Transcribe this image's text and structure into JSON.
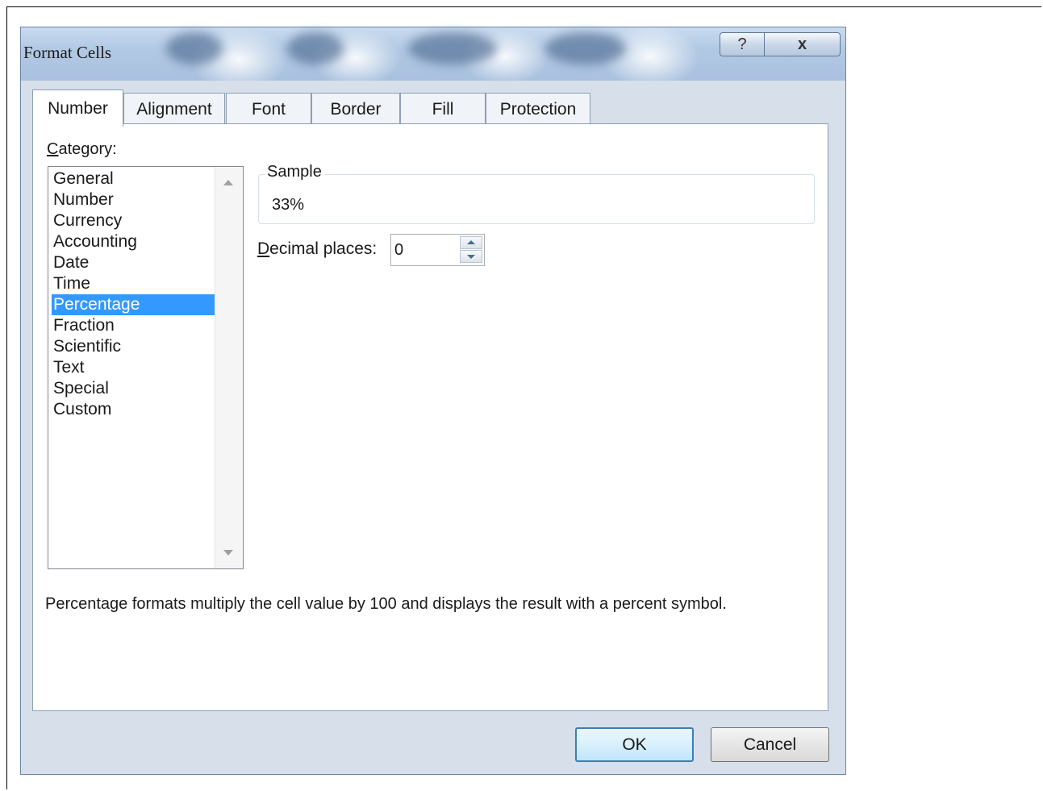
{
  "window": {
    "title": "Format Cells",
    "help_label": "?",
    "close_label": "x"
  },
  "tabs": [
    {
      "label": "Number"
    },
    {
      "label": "Alignment"
    },
    {
      "label": "Font"
    },
    {
      "label": "Border"
    },
    {
      "label": "Fill"
    },
    {
      "label": "Protection"
    }
  ],
  "active_tab": "Number",
  "category": {
    "label": "Category:",
    "items": [
      {
        "label": "General"
      },
      {
        "label": "Number"
      },
      {
        "label": "Currency"
      },
      {
        "label": "Accounting"
      },
      {
        "label": "Date"
      },
      {
        "label": "Time"
      },
      {
        "label": "Percentage"
      },
      {
        "label": "Fraction"
      },
      {
        "label": "Scientific"
      },
      {
        "label": "Text"
      },
      {
        "label": "Special"
      },
      {
        "label": "Custom"
      }
    ],
    "selected": "Percentage"
  },
  "sample": {
    "legend": "Sample",
    "value": "33%"
  },
  "decimal_places": {
    "label": "Decimal places:",
    "value": "0"
  },
  "description": "Percentage formats multiply the cell value by 100 and displays the result with a percent symbol.",
  "buttons": {
    "ok": "OK",
    "cancel": "Cancel"
  },
  "colors": {
    "selection": "#3399ff",
    "dialog_bg": "#d6dfea",
    "default_button_border": "#3c7fb1"
  }
}
